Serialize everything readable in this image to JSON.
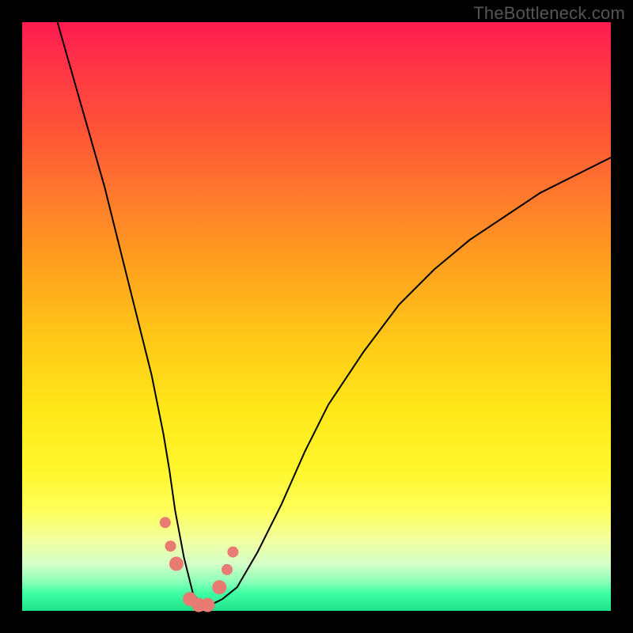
{
  "watermark": "TheBottleneck.com",
  "chart_data": {
    "type": "line",
    "title": "",
    "xlabel": "",
    "ylabel": "",
    "xlim": [
      0,
      100
    ],
    "ylim": [
      0,
      100
    ],
    "series": [
      {
        "name": "bottleneck-curve",
        "x": [
          6,
          8,
          10,
          12,
          14,
          16,
          18,
          20,
          22,
          24,
          25,
          26,
          27.5,
          29,
          30.5,
          32,
          34,
          36.5,
          40,
          44,
          48,
          52,
          58,
          64,
          70,
          76,
          82,
          88,
          94,
          100
        ],
        "y": [
          100,
          93,
          86,
          79,
          72,
          64,
          56,
          48,
          40,
          30,
          24,
          17,
          9,
          3,
          1,
          1,
          2,
          4,
          10,
          18,
          27,
          35,
          44,
          52,
          58,
          63,
          67,
          71,
          74,
          77
        ]
      }
    ],
    "markers": {
      "name": "highlighted-points",
      "x": [
        24.3,
        25.2,
        26.2,
        28.5,
        30.0,
        31.5,
        33.5,
        34.8,
        35.8
      ],
      "y": [
        15,
        11,
        8,
        2,
        1,
        1,
        4,
        7,
        10
      ],
      "r": [
        7,
        7,
        9,
        9,
        9,
        9,
        9,
        7,
        7
      ]
    }
  },
  "colors": {
    "marker": "#e87b72",
    "line": "#000000"
  }
}
